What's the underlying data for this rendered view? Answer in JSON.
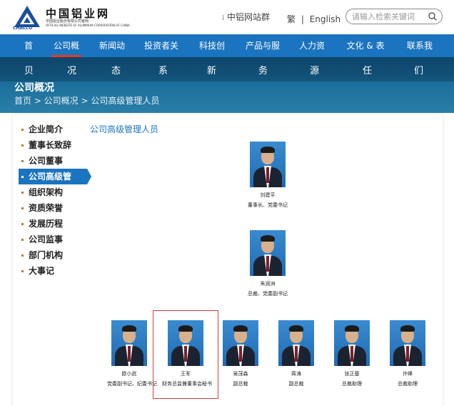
{
  "header": {
    "logo_name_cn": "中国铝业网",
    "logo_sub_cn": "中国铝业股份有限公司官网",
    "logo_sub_en": "OFFICIAL WEBSITE OF ALUMINUM CORPORATION OF CHINA",
    "logo_brand": "CHALCO",
    "group_link": "中铝网站群",
    "lang_trad": "繁",
    "lang_sep": "|",
    "lang_en": "English",
    "search_placeholder": "请输入检索关键词",
    "brand_color": "#1b74bf"
  },
  "nav": {
    "items": [
      "首",
      "公司概",
      "新闻动",
      "投资者关",
      "科技创",
      "产品与服",
      "人力资",
      "文化 & 表",
      "联系我"
    ],
    "active_index": 1
  },
  "banner": {
    "slogan_chars": [
      "贝",
      "况",
      "态",
      "系",
      "新",
      "务",
      "源",
      "任",
      "们"
    ],
    "title": "公司概况",
    "breadcrumb": "首页 > 公司概况 > 公司高级管理人员"
  },
  "sidebar": {
    "items": [
      {
        "label": "企业简介"
      },
      {
        "label": "董事长致辞"
      },
      {
        "label": "公司董事"
      },
      {
        "label": "公司高级管"
      },
      {
        "label": "组织架构"
      },
      {
        "label": "资质荣誉"
      },
      {
        "label": "发展历程"
      },
      {
        "label": "公司监事"
      },
      {
        "label": "部门机构"
      },
      {
        "label": "大事记"
      }
    ],
    "active_index": 3
  },
  "main": {
    "section_title": "公司高级管理人员",
    "people": [
      {
        "name": "刘建平",
        "title": "董事长、党委书记"
      },
      {
        "name": "朱润洲",
        "title": "总裁、党委副书记"
      },
      {
        "name": "欧小武",
        "title": "党委副书记、纪委书记"
      },
      {
        "name": "王军",
        "title": "财务总监兼董事会秘书"
      },
      {
        "name": "吴茂森",
        "title": "副总裁"
      },
      {
        "name": "蒋涛",
        "title": "副总裁"
      },
      {
        "name": "张正基",
        "title": "总裁助理"
      },
      {
        "name": "许峰",
        "title": "总裁助理"
      }
    ]
  }
}
